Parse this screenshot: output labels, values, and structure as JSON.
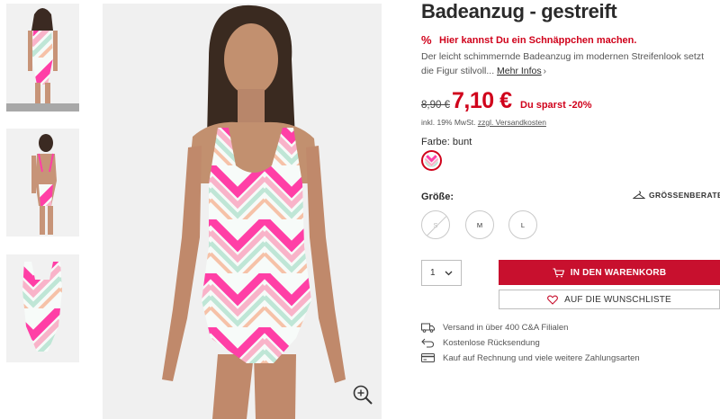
{
  "product": {
    "title": "Badeanzug - gestreift",
    "deal_icon": "%",
    "deal_text": "Hier kannst Du ein Schnäppchen machen.",
    "description": "Der leicht schimmernde Badeanzug im modernen Streifenlook setzt die Figur stilvoll...",
    "more_label": "Mehr Infos",
    "old_price": "8,90 €",
    "new_price": "7,10 €",
    "savings": "Du sparst -20%",
    "tax_prefix": "inkl. 19% MwSt.",
    "shipping_link": "zzgl. Versandkosten",
    "color_label": "Farbe: bunt",
    "size_label": "Größe:",
    "size_guide": "GRÖSSENBERATER",
    "sizes": [
      {
        "label": "S",
        "available": false
      },
      {
        "label": "M",
        "available": true
      },
      {
        "label": "L",
        "available": true
      }
    ],
    "quantity": "1",
    "cart_button": "IN DEN WARENKORB",
    "wishlist_button": "AUF DIE WUNSCHLISTE"
  },
  "benefits": [
    {
      "icon": "truck-icon",
      "text": "Versand in über 400 C&A Filialen"
    },
    {
      "icon": "return-arrow-icon",
      "text": "Kostenlose Rücksendung"
    },
    {
      "icon": "credit-card-icon",
      "text": "Kauf auf Rechnung und viele weitere Zahlungsarten"
    }
  ],
  "colors": {
    "accent_red": "#d0021b",
    "button_red": "#c8102e",
    "stripe_pink": "#ff3fa6",
    "stripe_light_pink": "#f9b3c9",
    "stripe_mint": "#bfe6d6",
    "stripe_peach": "#f6c2a8"
  },
  "icons": {
    "zoom": "zoom-in-icon",
    "size_guide": "hanger-icon",
    "cart": "cart-icon",
    "wishlist": "heart-icon",
    "quantity_dropdown": "chevron-down-icon"
  }
}
